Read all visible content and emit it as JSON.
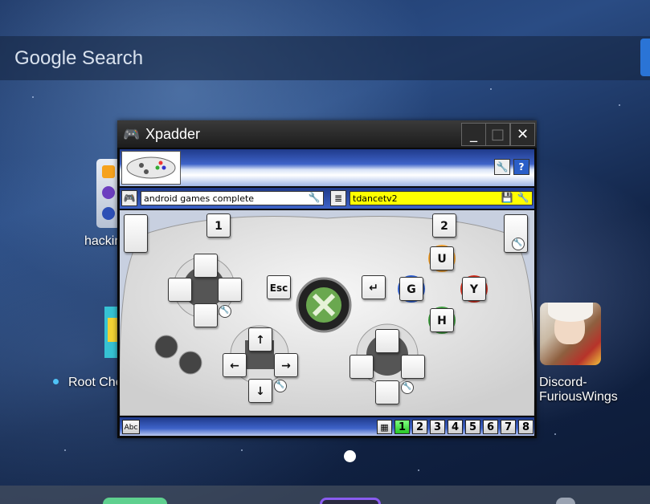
{
  "search": {
    "label": "Google Search"
  },
  "home_apps": [
    {
      "label": "hackin"
    },
    {
      "label": "Root Che"
    },
    {
      "label": "Discord-FuriousWings"
    }
  ],
  "window": {
    "title": "Xpadder",
    "min_glyph": "_",
    "max_glyph": "□",
    "close_glyph": "✕"
  },
  "toolbar": {
    "profile_name": "android games complete",
    "set_name": "tdancetv2"
  },
  "controller": {
    "left_trigger": "",
    "right_trigger": "",
    "left_bumper": "1",
    "right_bumper": "2",
    "back_key": "Esc",
    "start_key": "↵",
    "face_top": "U",
    "face_left": "G",
    "face_right": "Y",
    "face_bottom": "H",
    "dpad_up": "↑",
    "dpad_left": "←",
    "dpad_right": "→",
    "dpad_down": "↓"
  },
  "statusbar": {
    "text_button": "Abc",
    "sets": [
      "1",
      "2",
      "3",
      "4",
      "5",
      "6",
      "7",
      "8"
    ],
    "active_set": "1"
  },
  "colors": {
    "set_bar_yellow": "#ffff00",
    "active_set_green": "#26c626",
    "window_blue": "#3e63c8"
  }
}
